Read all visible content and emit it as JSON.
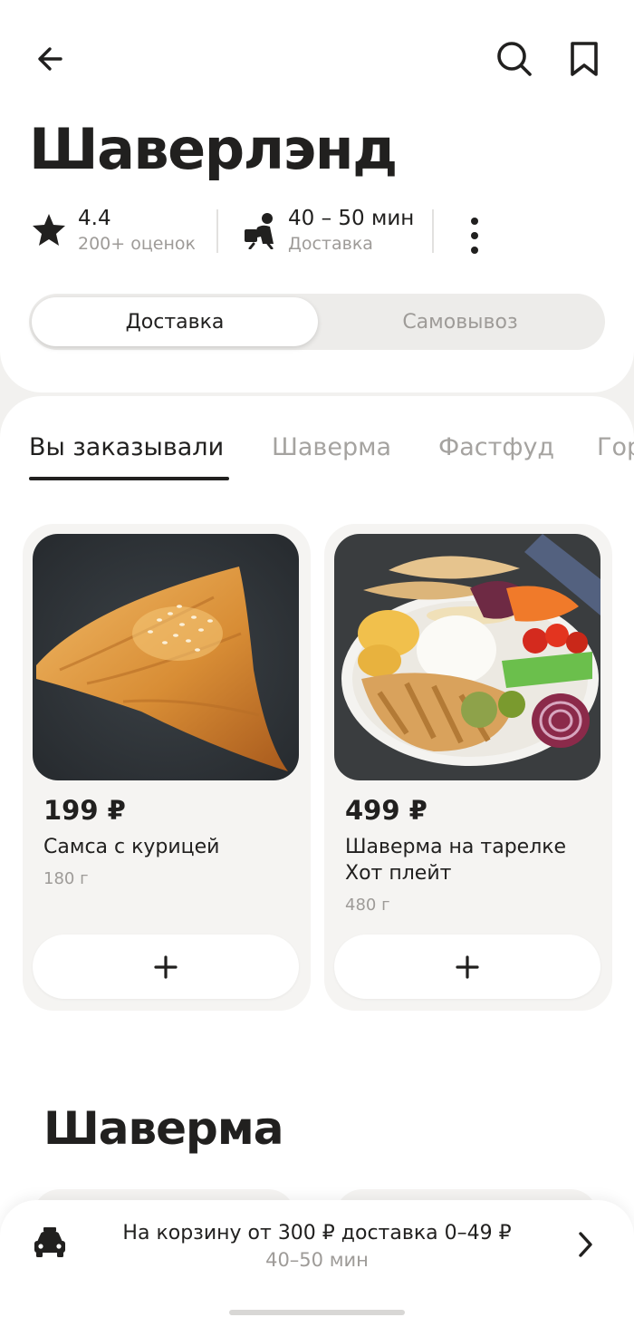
{
  "header": {
    "title": "Шаверлэнд",
    "back_icon": "arrow-left-icon",
    "search_icon": "search-icon",
    "bookmark_icon": "bookmark-icon"
  },
  "meta": {
    "rating": "4.4",
    "rating_sub": "200+ оценок",
    "delivery_time": "40 – 50 мин",
    "delivery_sub": "Доставка"
  },
  "mode_toggle": {
    "active": "Доставка",
    "inactive": "Самовывоз"
  },
  "tabs": [
    {
      "label": "Вы заказывали",
      "active": true
    },
    {
      "label": "Шаверма",
      "active": false
    },
    {
      "label": "Фастфуд",
      "active": false
    },
    {
      "label": "Гор",
      "active": false
    }
  ],
  "products": [
    {
      "price": "199 ₽",
      "name": "Самса с курицей",
      "weight": "180 г",
      "add_label": "+"
    },
    {
      "price": "499 ₽",
      "name": "Шаверма на тарелке Хот плейт",
      "weight": "480 г",
      "add_label": "+"
    }
  ],
  "section_title": "Шаверма",
  "bottom_bar": {
    "line1": "На корзину от 300 ₽ доставка 0–49 ₽",
    "line2": "40–50 мин"
  },
  "colors": {
    "text": "#21201f",
    "muted": "#9e9b98",
    "background": "#f2f1ef",
    "card": "#f5f4f2"
  }
}
